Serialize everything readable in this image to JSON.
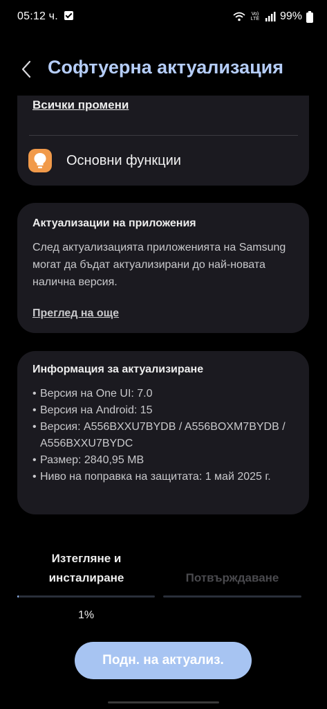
{
  "status_bar": {
    "time": "05:12 ч.",
    "battery": "99%",
    "network_label": "Vo) LTE"
  },
  "header": {
    "title": "Софтуерна актуализация"
  },
  "changes_card": {
    "all_changes": "Всички промени",
    "feature_label": "Основни функции"
  },
  "apps_card": {
    "title": "Актуализации на приложения",
    "body": "След актуализацията приложенията на Samsung могат да бъдат актуализирани до най-новата налична версия.",
    "see_more": "Преглед на още"
  },
  "info_card": {
    "title": "Информация за актуализиране",
    "items": [
      "Версия на One UI: 7.0",
      "Версия на Android: 15",
      "Версия: A556BXXU7BYDB / A556BOXM7BYDB / A556BXXU7BYDC",
      "Размер: 2840,95 MB",
      "Ниво на поправка на защитата: 1 май 2025 г."
    ]
  },
  "progress": {
    "step_1_label": "Изтегляне и инсталиране",
    "step_2_label": "Потвърждаване",
    "percent_text": "1%",
    "step_1_fraction": 0.01
  },
  "actions": {
    "pause_button": "Подн. на актуализ."
  },
  "colors": {
    "accent": "#b5cdf8",
    "button": "#a7c4f2",
    "card": "#1b1a20",
    "feature_icon": "#f19a4a"
  },
  "icons": {
    "back": "chevron-left-icon",
    "feature": "lightbulb-icon",
    "wifi": "wifi-icon",
    "signal": "signal-icon",
    "battery": "battery-icon",
    "notification": "check-box-icon"
  }
}
